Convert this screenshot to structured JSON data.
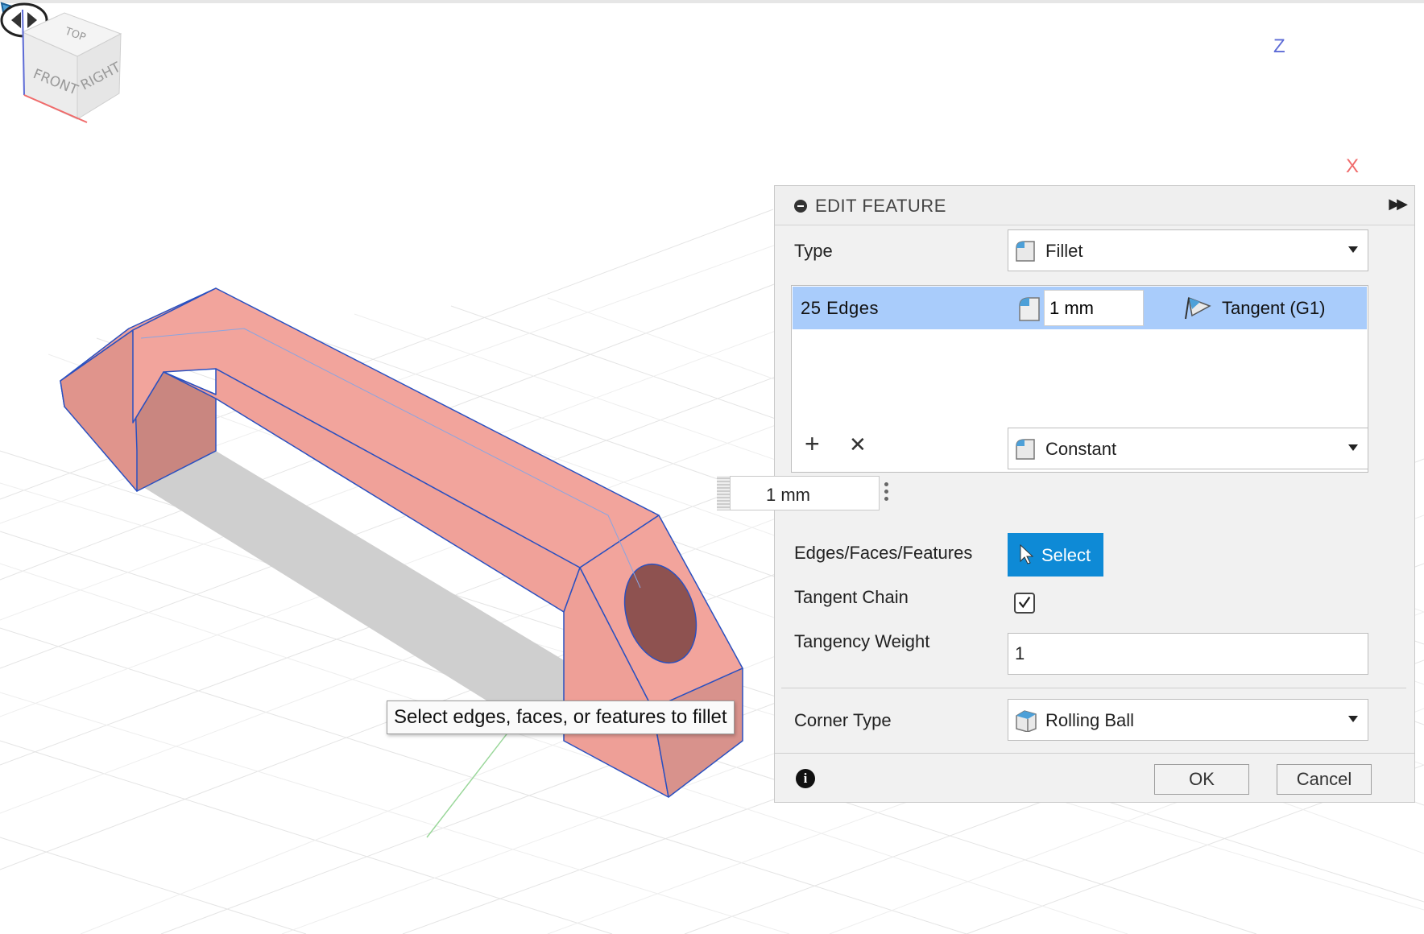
{
  "panel": {
    "title": "EDIT FEATURE",
    "type_label": "Type",
    "type_value": "Fillet",
    "edges": {
      "count": "25 Edges",
      "value": "1 mm",
      "continuity": "Tangent (G1)"
    },
    "size_value": "1 mm",
    "radius_type": "Constant",
    "edges_label": "Edges/Faces/Features",
    "select_label": "Select",
    "tangent_chain_label": "Tangent Chain",
    "tangent_chain_checked": true,
    "tangency_weight_label": "Tangency Weight",
    "tangency_weight_value": "1",
    "corner_type_label": "Corner Type",
    "corner_type_value": "Rolling Ball",
    "ok_label": "OK",
    "cancel_label": "Cancel"
  },
  "tooltip": "Select edges, faces, or features to fillet",
  "viewcube": {
    "top": "TOP",
    "front": "FRONT",
    "right": "RIGHT",
    "axis_z": "Z",
    "axis_x": "X"
  },
  "colors": {
    "model_fill": "#f2a49c",
    "model_edge": "#2a50c0",
    "selection_highlight": "#a9ccfb",
    "select_button": "#0e8ad6"
  },
  "icons": {
    "collapse": "minus-circle-icon",
    "expand": "double-chevron-right-icon",
    "fillet": "fillet-icon",
    "tangent": "tangent-flag-icon",
    "select": "cursor-arrow-icon",
    "info": "info-icon"
  }
}
